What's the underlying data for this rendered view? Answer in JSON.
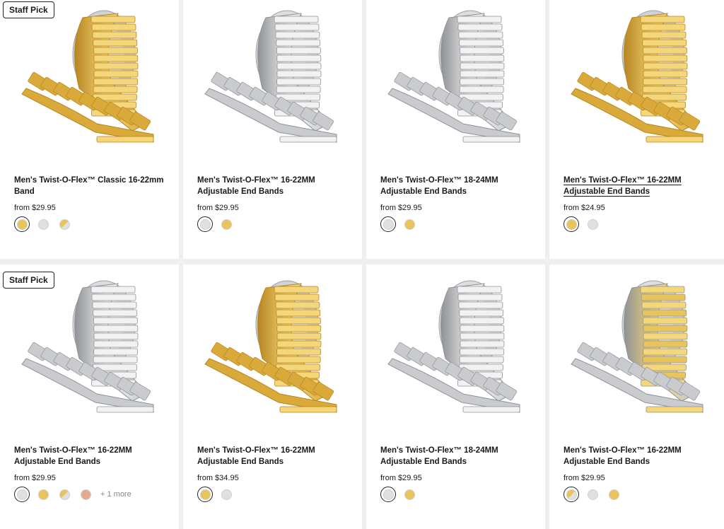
{
  "staff_badge": "Staff Pick",
  "colors": {
    "gold": "#e8c45a",
    "silver": "#e0e0e0",
    "rose": "#e6a98d"
  },
  "products": [
    {
      "title": "Men's Twist-O-Flex™ Classic 16-22mm Band",
      "price": "from $29.95",
      "image": "gold-band",
      "swatches": [
        "gold",
        "silver",
        "twotone"
      ],
      "selected": 0,
      "more": ""
    },
    {
      "title": "Men's Twist-O-Flex™ 16-22MM Adjustable End Bands",
      "price": "from $29.95",
      "image": "silver-band",
      "swatches": [
        "silver",
        "gold"
      ],
      "selected": 0,
      "more": ""
    },
    {
      "title": "Men's Twist-O-Flex™ 18-24MM Adjustable End Bands",
      "price": "from $29.95",
      "image": "silver-band",
      "swatches": [
        "silver",
        "gold"
      ],
      "selected": 0,
      "more": ""
    },
    {
      "title": "Men's Twist-O-Flex™ 16-22MM Adjustable End Bands",
      "price": "from $24.95",
      "image": "gold-band",
      "swatches": [
        "gold",
        "silver"
      ],
      "selected": 0,
      "more": ""
    },
    {
      "title": "Men's Twist-O-Flex™ 16-22MM Adjustable End Bands",
      "price": "from $29.95",
      "image": "silver-band",
      "swatches": [
        "silver",
        "gold",
        "twotone",
        "rose"
      ],
      "selected": 0,
      "more": "+ 1 more"
    },
    {
      "title": "Men's Twist-O-Flex™ 16-22MM Adjustable End Bands",
      "price": "from $34.95",
      "image": "gold-band",
      "swatches": [
        "gold",
        "silver"
      ],
      "selected": 0,
      "more": ""
    },
    {
      "title": "Men's Twist-O-Flex™ 18-24MM Adjustable End Bands",
      "price": "from $29.95",
      "image": "silver-band",
      "swatches": [
        "silver",
        "gold"
      ],
      "selected": 0,
      "more": ""
    },
    {
      "title": "Men's Twist-O-Flex™ 16-22MM Adjustable End Bands",
      "price": "from $29.95",
      "image": "twotone-band",
      "swatches": [
        "twotone",
        "silver",
        "gold"
      ],
      "selected": 0,
      "more": ""
    }
  ]
}
